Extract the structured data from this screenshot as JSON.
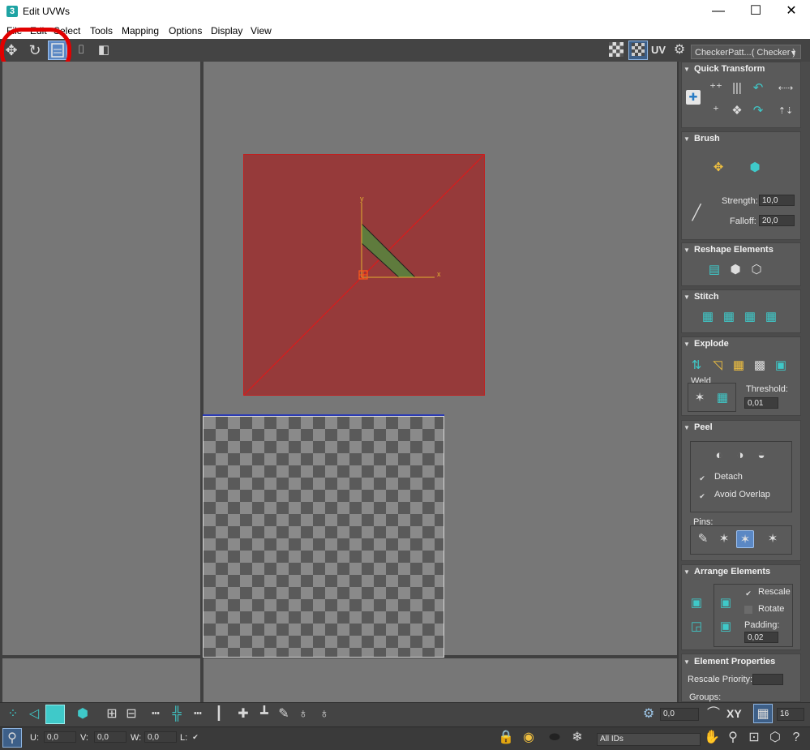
{
  "window": {
    "title": "Edit UVWs",
    "app_icon_text": "3",
    "minimize": "—",
    "maximize": "☐",
    "close": "✕"
  },
  "menu": {
    "items": [
      "File",
      "Edit",
      "Select",
      "Tools",
      "Mapping",
      "Options",
      "Display",
      "View"
    ]
  },
  "toolbar": {
    "uv_label": "UV",
    "checker_value": "CheckerPatt...( Checker )",
    "icons": [
      "move-icon",
      "rotate-icon",
      "freeform-mode-icon",
      "mirror-icon",
      "flip-icon",
      "checker-icon-1",
      "checker-icon-2",
      "texture-settings-icon"
    ]
  },
  "viewport": {
    "gizmo_y_label": "y",
    "gizmo_x_label": "x",
    "colors": {
      "uv_square": "#963a3a",
      "shell": "#5a7a3a",
      "gizmo": "#e0b030"
    }
  },
  "panel": {
    "quick_transform": {
      "title": "Quick Transform"
    },
    "brush": {
      "title": "Brush",
      "strength_label": "Strength:",
      "strength_value": "10,0",
      "falloff_label": "Falloff:",
      "falloff_value": "20,0"
    },
    "reshape": {
      "title": "Reshape Elements"
    },
    "stitch": {
      "title": "Stitch"
    },
    "explode": {
      "title": "Explode",
      "weld_label": "Weld",
      "threshold_label": "Threshold:",
      "threshold_value": "0,01"
    },
    "peel": {
      "title": "Peel",
      "detach_label": "Detach",
      "avoid_overlap_label": "Avoid Overlap",
      "pins_label": "Pins:"
    },
    "arrange": {
      "title": "Arrange Elements",
      "rescale_label": "Rescale",
      "rotate_label": "Rotate",
      "padding_label": "Padding:",
      "padding_value": "0,02"
    },
    "element_properties": {
      "title": "Element Properties",
      "rescale_priority_label": "Rescale Priority:",
      "groups_label": "Groups:"
    }
  },
  "bottom": {
    "angle_value": "0,0",
    "xy_label": "XY",
    "snap_value": "16",
    "u_label": "U:",
    "u_value": "0,0",
    "v_label": "V:",
    "v_value": "0,0",
    "w_label": "W:",
    "w_value": "0,0",
    "l_label": "L:",
    "ids_value": "All IDs"
  }
}
